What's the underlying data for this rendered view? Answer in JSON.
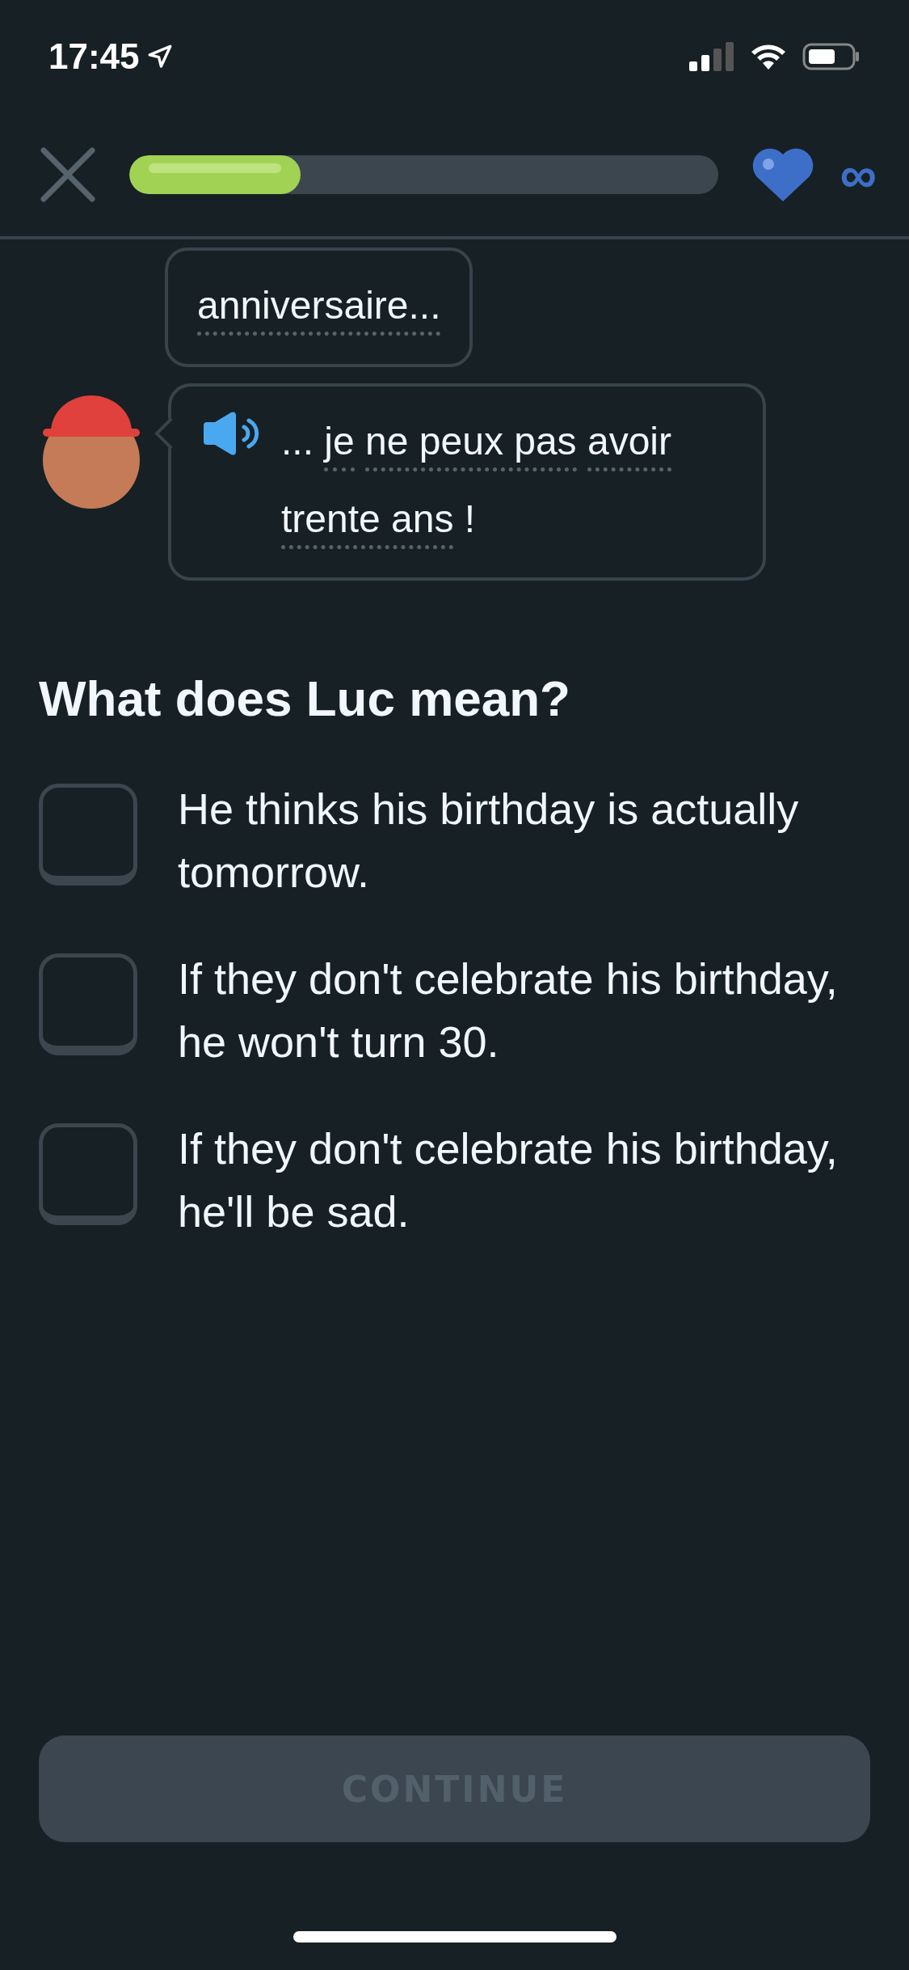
{
  "status_bar": {
    "time": "17:45"
  },
  "header": {
    "progress": {
      "level": 0.29
    },
    "hearts": "∞"
  },
  "messages": [
    {
      "avatar": false,
      "audio": false,
      "tokens": [
        {
          "text": "anniversaire...",
          "hint": true
        }
      ]
    },
    {
      "avatar": true,
      "audio": true,
      "tokens": [
        {
          "text": "...",
          "hint": false
        },
        {
          "text": "je",
          "hint": true
        },
        {
          "text": "ne peux pas",
          "hint": true
        },
        {
          "text": "avoir",
          "hint": true
        },
        {
          "text": "trente ans",
          "hint": true
        },
        {
          "text": "!",
          "hint": false
        }
      ]
    }
  ],
  "question": "What does Luc mean?",
  "options": [
    {
      "text": "He thinks his birthday is actually tomorrow.",
      "checked": false
    },
    {
      "text": "If they don't celebrate his birthday, he won't turn 30.",
      "checked": false
    },
    {
      "text": "If they don't celebrate his birthday, he'll be sad.",
      "checked": false
    }
  ],
  "continue_button": {
    "label": "CONTINUE",
    "disabled": true
  }
}
